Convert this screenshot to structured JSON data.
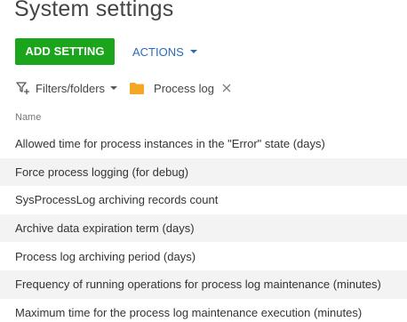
{
  "page": {
    "title": "System settings"
  },
  "toolbar": {
    "add_label": "ADD SETTING",
    "actions_label": "ACTIONS"
  },
  "filters": {
    "label": "Filters/folders",
    "folder_name": "Process log"
  },
  "grid": {
    "column_header": "Name",
    "rows": [
      "Allowed time for process instances in the \"Error\" state (days)",
      "Force process logging (for debug)",
      "SysProcessLog archiving records count",
      "Archive data expiration term (days)",
      "Process log archiving period (days)",
      "Frequency of running operations for process log maintenance (minutes)",
      "Maximum time for the process log maintenance execution (minutes)"
    ]
  },
  "colors": {
    "primary_button": "#1aa51c",
    "link": "#2a6bb8",
    "folder": "#f5a623",
    "alt_row": "#f3f3f3"
  },
  "icons": {
    "filter": "filter-icon",
    "folder": "folder-icon",
    "close": "close-icon",
    "caret": "caret-down-icon"
  }
}
